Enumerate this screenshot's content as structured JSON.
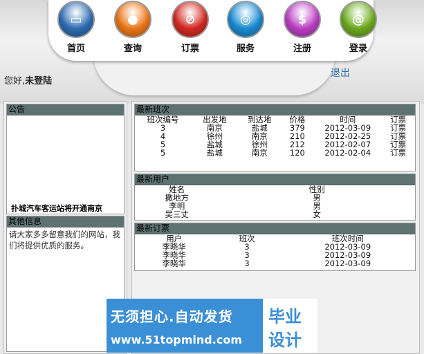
{
  "nav": [
    {
      "name": "nav-home",
      "label": "首页",
      "icon": "monitor-icon",
      "glyph": "▭",
      "color": "#2f6fb5"
    },
    {
      "name": "nav-query",
      "label": "查询",
      "icon": "user-icon",
      "glyph": "●",
      "color": "#f07a1c"
    },
    {
      "name": "nav-ticket",
      "label": "订票",
      "icon": "ticket-icon",
      "glyph": "⊘",
      "color": "#d72a25"
    },
    {
      "name": "nav-service",
      "label": "服务",
      "icon": "disc-icon",
      "glyph": "◎",
      "color": "#1b8ed6"
    },
    {
      "name": "nav-register",
      "label": "注册",
      "icon": "dollar-icon",
      "glyph": "$",
      "color": "#c041c8"
    },
    {
      "name": "nav-login",
      "label": "登录",
      "icon": "at-icon",
      "glyph": "@",
      "color": "#6fae1f"
    }
  ],
  "header": {
    "greeting": "您好,",
    "status": "未登陆",
    "logout": "退出"
  },
  "notice": {
    "title": "公告",
    "text": "扑城汽车客运站将开通南京"
  },
  "other": {
    "title": "其他信息",
    "text": "请大家多多留意我们的网站，我们将提供优质的服务。"
  },
  "latest_routes": {
    "title": "最新班次",
    "headers": [
      "班次编号",
      "出发地",
      "到达地",
      "价格",
      "时间",
      "订票"
    ],
    "rows": [
      [
        "3",
        "南京",
        "盐城",
        "379",
        "2012-03-09",
        "订票"
      ],
      [
        "4",
        "徐州",
        "南京",
        "210",
        "2012-02-25",
        "订票"
      ],
      [
        "5",
        "盐城",
        "徐州",
        "212",
        "2012-02-07",
        "订票"
      ],
      [
        "5",
        "盐城",
        "南京",
        "120",
        "2012-02-04",
        "订票"
      ]
    ]
  },
  "latest_users": {
    "title": "最新用户",
    "headers": [
      "姓名",
      "性别"
    ],
    "rows": [
      [
        "撒地方",
        "男"
      ],
      [
        "李明",
        "男"
      ],
      [
        "吴三丈",
        "女"
      ]
    ]
  },
  "latest_orders": {
    "title": "最新订票",
    "headers": [
      "用户",
      "班次",
      "班次时间"
    ],
    "rows": [
      [
        "李晓华",
        "3",
        "2012-03-09"
      ],
      [
        "李晓华",
        "3",
        "2012-03-09"
      ],
      [
        "李晓华",
        "3",
        "2012-03-09"
      ]
    ]
  },
  "banner": {
    "main": "无须担心.自动发货",
    "url": "www.51topmind.com",
    "right1": "毕业",
    "right2": "设计"
  }
}
